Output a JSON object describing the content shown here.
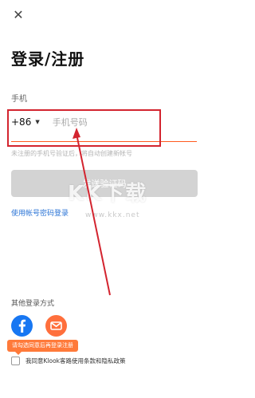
{
  "header": {
    "close_icon": "close-icon",
    "close_glyph": "✕"
  },
  "title": {
    "text": "登录/注册"
  },
  "phone": {
    "label": "手机",
    "country_code": "+86",
    "caret": "▼",
    "placeholder": "手机号码",
    "hint": "未注册的手机号验证后，将自动创建新帐号"
  },
  "actions": {
    "send_code": "发送验证码",
    "password_login": "使用帐号密码登录"
  },
  "other_login": {
    "label": "其他登录方式",
    "providers": [
      "facebook-icon",
      "email-icon"
    ]
  },
  "agreement": {
    "tooltip": "请勾选同意后再登录注册",
    "prefix": "我同意",
    "terms": "Klook客路使用条款",
    "and": "和",
    "privacy": "隐私政策"
  },
  "watermark": {
    "text": "KK下载",
    "sub": "www.kkx.net"
  },
  "colors": {
    "accent": "#ff5a1f",
    "annotation": "#d3242f",
    "link": "#2b74d6",
    "facebook": "#1877f2",
    "email": "#ff6f3c",
    "disabled_button": "#d3d3d3"
  }
}
